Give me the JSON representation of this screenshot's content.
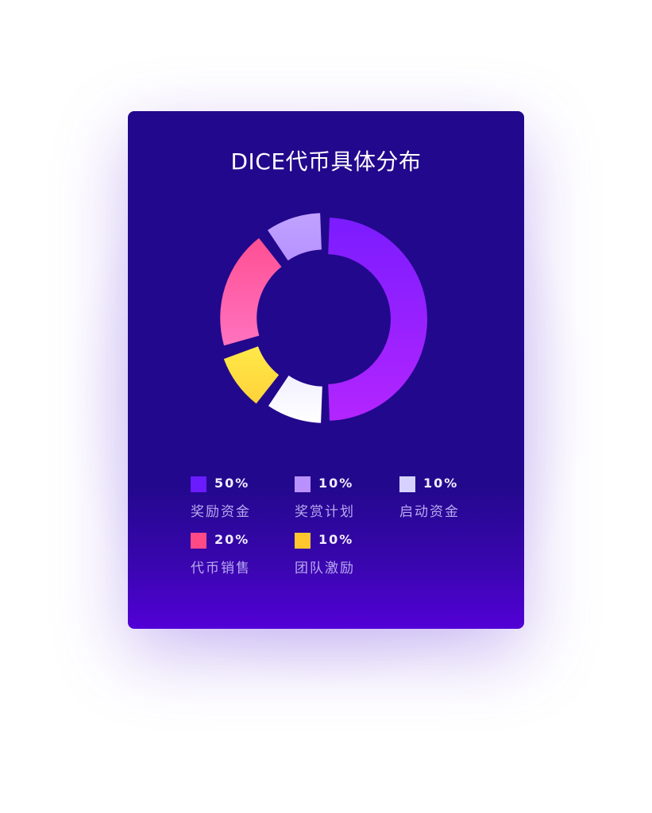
{
  "chart_data": {
    "type": "pie",
    "title": "DICE代币具体分布",
    "slices": [
      {
        "label": "奖励资金",
        "value": 50,
        "value_label": "50%",
        "color": "#7b1cff",
        "color_end": "#b325ff"
      },
      {
        "label": "启动资金",
        "value": 10,
        "value_label": "10%",
        "color": "#f2f0ff",
        "color_end": "#ffffff"
      },
      {
        "label": "团队激励",
        "value": 10,
        "value_label": "10%",
        "color": "#ffe949",
        "color_end": "#ffd23a"
      },
      {
        "label": "代币销售",
        "value": 20,
        "value_label": "20%",
        "color": "#ff4f93",
        "color_end": "#ff73bf"
      },
      {
        "label": "奖赏计划",
        "value": 10,
        "value_label": "10%",
        "color": "#c0a2ff",
        "color_end": "#b792ff"
      }
    ],
    "legend": [
      {
        "label": "奖励资金",
        "value_label": "50%",
        "swatch": "#6a1bff"
      },
      {
        "label": "奖赏计划",
        "value_label": "10%",
        "swatch": "#b991ff"
      },
      {
        "label": "启动资金",
        "value_label": "10%",
        "swatch": "#d6d2ff"
      },
      {
        "label": "代币销售",
        "value_label": "20%",
        "swatch": "#ff4a86"
      },
      {
        "label": "团队激励",
        "value_label": "10%",
        "swatch": "#ffc62e"
      }
    ],
    "legend_placement": "bottom"
  },
  "colors": {
    "card_background": "#22088c",
    "card_background_bottom": "#5200d6",
    "title_text": "#ffffff",
    "legend_value_text": "#f2ecff",
    "legend_label_text": "#b9aaf0"
  }
}
